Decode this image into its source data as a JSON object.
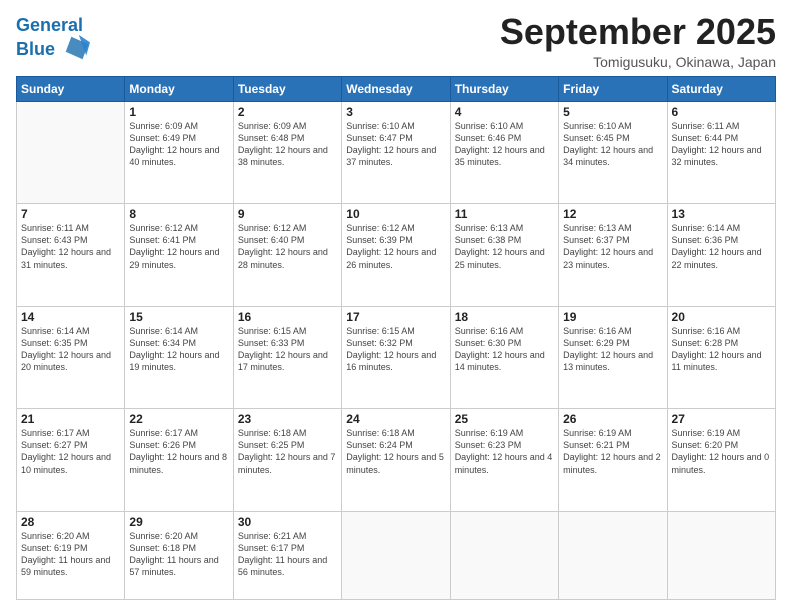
{
  "header": {
    "logo_line1": "General",
    "logo_line2": "Blue",
    "month": "September 2025",
    "location": "Tomigusuku, Okinawa, Japan"
  },
  "weekdays": [
    "Sunday",
    "Monday",
    "Tuesday",
    "Wednesday",
    "Thursday",
    "Friday",
    "Saturday"
  ],
  "weeks": [
    [
      null,
      {
        "day": "1",
        "sunrise": "6:09 AM",
        "sunset": "6:49 PM",
        "daylight": "12 hours and 40 minutes."
      },
      {
        "day": "2",
        "sunrise": "6:09 AM",
        "sunset": "6:48 PM",
        "daylight": "12 hours and 38 minutes."
      },
      {
        "day": "3",
        "sunrise": "6:10 AM",
        "sunset": "6:47 PM",
        "daylight": "12 hours and 37 minutes."
      },
      {
        "day": "4",
        "sunrise": "6:10 AM",
        "sunset": "6:46 PM",
        "daylight": "12 hours and 35 minutes."
      },
      {
        "day": "5",
        "sunrise": "6:10 AM",
        "sunset": "6:45 PM",
        "daylight": "12 hours and 34 minutes."
      },
      {
        "day": "6",
        "sunrise": "6:11 AM",
        "sunset": "6:44 PM",
        "daylight": "12 hours and 32 minutes."
      }
    ],
    [
      {
        "day": "7",
        "sunrise": "6:11 AM",
        "sunset": "6:43 PM",
        "daylight": "12 hours and 31 minutes."
      },
      {
        "day": "8",
        "sunrise": "6:12 AM",
        "sunset": "6:41 PM",
        "daylight": "12 hours and 29 minutes."
      },
      {
        "day": "9",
        "sunrise": "6:12 AM",
        "sunset": "6:40 PM",
        "daylight": "12 hours and 28 minutes."
      },
      {
        "day": "10",
        "sunrise": "6:12 AM",
        "sunset": "6:39 PM",
        "daylight": "12 hours and 26 minutes."
      },
      {
        "day": "11",
        "sunrise": "6:13 AM",
        "sunset": "6:38 PM",
        "daylight": "12 hours and 25 minutes."
      },
      {
        "day": "12",
        "sunrise": "6:13 AM",
        "sunset": "6:37 PM",
        "daylight": "12 hours and 23 minutes."
      },
      {
        "day": "13",
        "sunrise": "6:14 AM",
        "sunset": "6:36 PM",
        "daylight": "12 hours and 22 minutes."
      }
    ],
    [
      {
        "day": "14",
        "sunrise": "6:14 AM",
        "sunset": "6:35 PM",
        "daylight": "12 hours and 20 minutes."
      },
      {
        "day": "15",
        "sunrise": "6:14 AM",
        "sunset": "6:34 PM",
        "daylight": "12 hours and 19 minutes."
      },
      {
        "day": "16",
        "sunrise": "6:15 AM",
        "sunset": "6:33 PM",
        "daylight": "12 hours and 17 minutes."
      },
      {
        "day": "17",
        "sunrise": "6:15 AM",
        "sunset": "6:32 PM",
        "daylight": "12 hours and 16 minutes."
      },
      {
        "day": "18",
        "sunrise": "6:16 AM",
        "sunset": "6:30 PM",
        "daylight": "12 hours and 14 minutes."
      },
      {
        "day": "19",
        "sunrise": "6:16 AM",
        "sunset": "6:29 PM",
        "daylight": "12 hours and 13 minutes."
      },
      {
        "day": "20",
        "sunrise": "6:16 AM",
        "sunset": "6:28 PM",
        "daylight": "12 hours and 11 minutes."
      }
    ],
    [
      {
        "day": "21",
        "sunrise": "6:17 AM",
        "sunset": "6:27 PM",
        "daylight": "12 hours and 10 minutes."
      },
      {
        "day": "22",
        "sunrise": "6:17 AM",
        "sunset": "6:26 PM",
        "daylight": "12 hours and 8 minutes."
      },
      {
        "day": "23",
        "sunrise": "6:18 AM",
        "sunset": "6:25 PM",
        "daylight": "12 hours and 7 minutes."
      },
      {
        "day": "24",
        "sunrise": "6:18 AM",
        "sunset": "6:24 PM",
        "daylight": "12 hours and 5 minutes."
      },
      {
        "day": "25",
        "sunrise": "6:19 AM",
        "sunset": "6:23 PM",
        "daylight": "12 hours and 4 minutes."
      },
      {
        "day": "26",
        "sunrise": "6:19 AM",
        "sunset": "6:21 PM",
        "daylight": "12 hours and 2 minutes."
      },
      {
        "day": "27",
        "sunrise": "6:19 AM",
        "sunset": "6:20 PM",
        "daylight": "12 hours and 0 minutes."
      }
    ],
    [
      {
        "day": "28",
        "sunrise": "6:20 AM",
        "sunset": "6:19 PM",
        "daylight": "11 hours and 59 minutes."
      },
      {
        "day": "29",
        "sunrise": "6:20 AM",
        "sunset": "6:18 PM",
        "daylight": "11 hours and 57 minutes."
      },
      {
        "day": "30",
        "sunrise": "6:21 AM",
        "sunset": "6:17 PM",
        "daylight": "11 hours and 56 minutes."
      },
      null,
      null,
      null,
      null
    ]
  ]
}
